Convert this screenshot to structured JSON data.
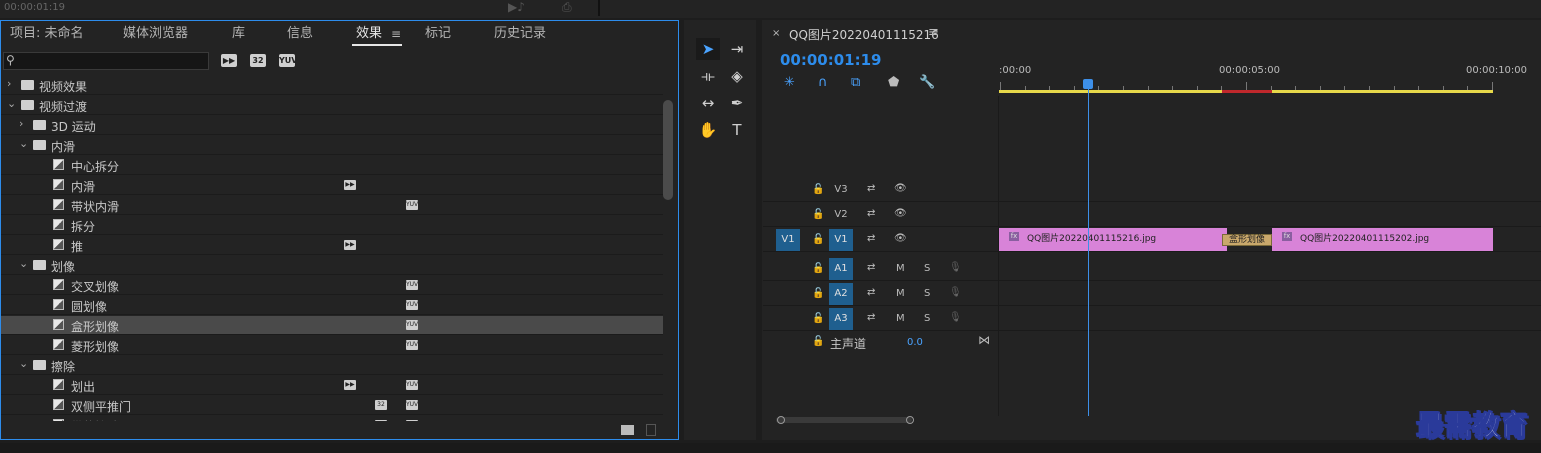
{
  "top": {
    "timecode": "00:00:01:19"
  },
  "effects_panel": {
    "tabs": [
      {
        "label": "项目: 未命名"
      },
      {
        "label": "媒体浏览器"
      },
      {
        "label": "库"
      },
      {
        "label": "信息"
      },
      {
        "label": "效果"
      },
      {
        "label": "标记"
      },
      {
        "label": "历史记录"
      }
    ],
    "active_tab": "效果",
    "menu_glyph": "≡",
    "search": {
      "value": "",
      "placeholder": ""
    },
    "filters": [
      "加速效果",
      "32位",
      "YUV"
    ],
    "filter_glyphs": [
      "▶▶",
      "32",
      "YUV"
    ],
    "tree": [
      {
        "label": "视频效果",
        "depth": 0,
        "kind": "folder",
        "expanded": false
      },
      {
        "label": "视频过渡",
        "depth": 0,
        "kind": "folder",
        "expanded": true
      },
      {
        "label": "3D 运动",
        "depth": 1,
        "kind": "folder",
        "expanded": false
      },
      {
        "label": "内滑",
        "depth": 1,
        "kind": "folder",
        "expanded": true
      },
      {
        "label": "中心拆分",
        "depth": 2,
        "kind": "effect",
        "badges": []
      },
      {
        "label": "内滑",
        "depth": 2,
        "kind": "effect",
        "badges": [
          "accel"
        ]
      },
      {
        "label": "带状内滑",
        "depth": 2,
        "kind": "effect",
        "badges": [
          "yuv"
        ]
      },
      {
        "label": "拆分",
        "depth": 2,
        "kind": "effect",
        "badges": []
      },
      {
        "label": "推",
        "depth": 2,
        "kind": "effect",
        "badges": [
          "accel"
        ]
      },
      {
        "label": "划像",
        "depth": 1,
        "kind": "folder",
        "expanded": true
      },
      {
        "label": "交叉划像",
        "depth": 2,
        "kind": "effect",
        "badges": [
          "yuv"
        ]
      },
      {
        "label": "圆划像",
        "depth": 2,
        "kind": "effect",
        "badges": [
          "yuv"
        ]
      },
      {
        "label": "盒形划像",
        "depth": 2,
        "kind": "effect",
        "badges": [
          "yuv"
        ],
        "selected": true
      },
      {
        "label": "菱形划像",
        "depth": 2,
        "kind": "effect",
        "badges": [
          "yuv"
        ]
      },
      {
        "label": "擦除",
        "depth": 1,
        "kind": "folder",
        "expanded": true
      },
      {
        "label": "划出",
        "depth": 2,
        "kind": "effect",
        "badges": [
          "accel",
          "yuv"
        ]
      },
      {
        "label": "双侧平推门",
        "depth": 2,
        "kind": "effect",
        "badges": [
          "32",
          "yuv"
        ]
      },
      {
        "label": "带状擦除",
        "depth": 2,
        "kind": "effect",
        "badges": [
          "32",
          "yuv"
        ]
      }
    ]
  },
  "tools": [
    {
      "name": "selection-tool",
      "glyph": "➤",
      "active": true
    },
    {
      "name": "track-select-tool",
      "glyph": "⇥",
      "active": false
    },
    {
      "name": "ripple-edit-tool",
      "glyph": "⟛",
      "active": false
    },
    {
      "name": "razor-tool",
      "glyph": "◈",
      "active": false
    },
    {
      "name": "slip-tool",
      "glyph": "↔",
      "active": false
    },
    {
      "name": "pen-tool",
      "glyph": "✒",
      "active": false
    },
    {
      "name": "hand-tool",
      "glyph": "✋",
      "active": false
    },
    {
      "name": "type-tool",
      "glyph": "T",
      "active": false
    }
  ],
  "timeline": {
    "close_glyph": "×",
    "sequence_name": "QQ图片20220401115216",
    "menu_glyph": "≡",
    "timecode": "00:00:01:19",
    "ruler_labels": [
      ":00:00",
      "00:00:05:00",
      "00:00:10:00"
    ],
    "playhead_seconds": 1.79,
    "clip_edge_seconds": 4.5,
    "end_seconds": 10.0,
    "tracks": [
      {
        "name": "V3",
        "type": "video",
        "source": "",
        "target": false
      },
      {
        "name": "V2",
        "type": "video",
        "source": "",
        "target": false
      },
      {
        "name": "V1",
        "type": "video",
        "source": "V1",
        "target": true
      },
      {
        "name": "A1",
        "type": "audio",
        "source": "",
        "target": true
      },
      {
        "name": "A2",
        "type": "audio",
        "source": "",
        "target": true
      },
      {
        "name": "A3",
        "type": "audio",
        "source": "",
        "target": true
      }
    ],
    "mute_label": "M",
    "solo_label": "S",
    "clips": [
      {
        "label": "QQ图片20220401115216.jpg",
        "fx": "fx"
      },
      {
        "label": "QQ图片20220401115202.jpg",
        "fx": "fx"
      }
    ],
    "transition": {
      "label": "盒形划像"
    },
    "master": {
      "label": "主声道",
      "value": "0.0"
    }
  },
  "watermark": "最需教育"
}
